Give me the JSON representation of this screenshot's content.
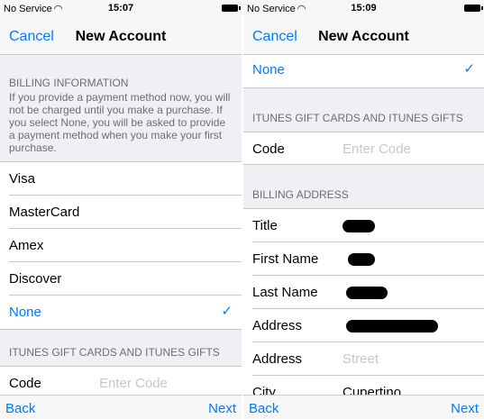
{
  "left": {
    "status": {
      "carrier": "No Service",
      "time": "15:07"
    },
    "nav": {
      "cancel": "Cancel",
      "title": "New Account"
    },
    "billing_info": {
      "header": "BILLING INFORMATION",
      "description": "If you provide a payment method now, you will not be charged until you make a purchase. If you select None, you will be asked to provide a payment method when you make your first purchase."
    },
    "payment_options": [
      {
        "label": "Visa"
      },
      {
        "label": "MasterCard"
      },
      {
        "label": "Amex"
      },
      {
        "label": "Discover"
      },
      {
        "label": "None",
        "selected": true
      }
    ],
    "gift": {
      "header": "ITUNES GIFT CARDS AND ITUNES GIFTS",
      "code_label": "Code",
      "code_placeholder": "Enter Code"
    },
    "bottom": {
      "back": "Back",
      "next": "Next"
    }
  },
  "right": {
    "status": {
      "carrier": "No Service",
      "time": "15:09"
    },
    "nav": {
      "cancel": "Cancel",
      "title": "New Account"
    },
    "selected_option": "None",
    "gift": {
      "header": "ITUNES GIFT CARDS AND ITUNES GIFTS",
      "code_label": "Code",
      "code_placeholder": "Enter Code"
    },
    "billing_address": {
      "header": "BILLING ADDRESS",
      "fields": [
        {
          "label": "Title"
        },
        {
          "label": "First Name"
        },
        {
          "label": "Last Name"
        },
        {
          "label": "Address"
        },
        {
          "label": "Address",
          "placeholder": "Street"
        },
        {
          "label": "City",
          "placeholder": "Cupertino"
        }
      ]
    },
    "bottom": {
      "back": "Back",
      "next": "Next"
    }
  },
  "colors": {
    "accent": "#007aff",
    "background": "#efeff4",
    "separator": "#c8c7cc"
  },
  "icons": {
    "wifi": "wifi-icon",
    "battery": "battery-icon",
    "check": "checkmark-icon"
  }
}
